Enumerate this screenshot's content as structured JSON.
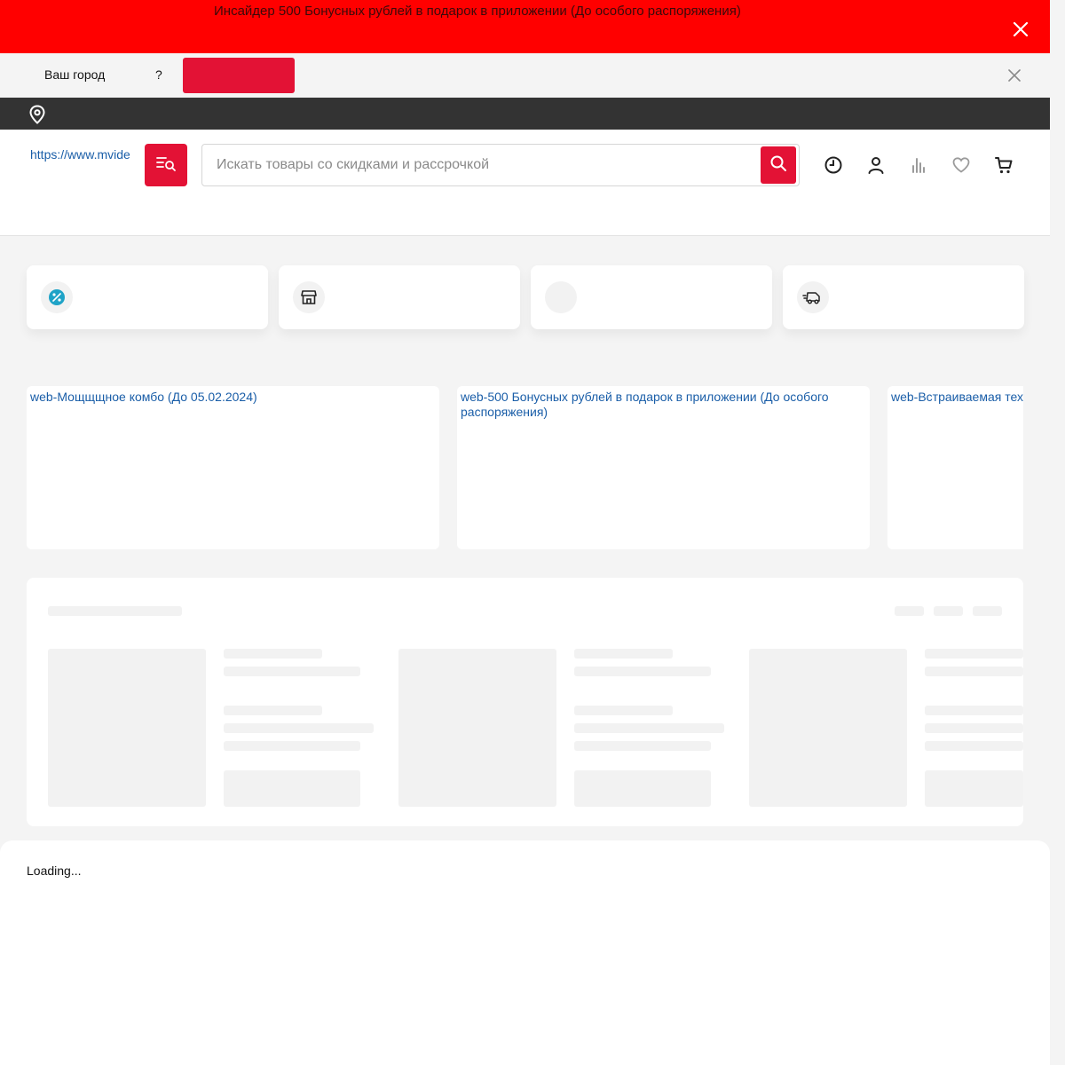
{
  "promo": {
    "text": "Инсайдер 500 Бонусных рублей в подарок в приложении (До особого распоряжения)",
    "close_icon": "close-icon"
  },
  "city": {
    "label": "Ваш город",
    "question": "?",
    "confirm_label": "",
    "close_icon": "close-icon"
  },
  "header": {
    "logo_link": "https://www.mvideo.ru",
    "search_placeholder": "Искать товары со скидками и рассрочкой",
    "icons": [
      "history-icon",
      "user-icon",
      "compare-icon",
      "heart-icon",
      "cart-icon"
    ]
  },
  "quick_links": [
    {
      "icon": "percent-icon"
    },
    {
      "icon": "store-icon"
    },
    {
      "icon": ""
    },
    {
      "icon": "delivery-truck-icon"
    }
  ],
  "banners": [
    {
      "label": "web-Мощщщное комбо (До 05.02.2024)"
    },
    {
      "label": "web-500 Бонусных рублей в подарок в приложении (До особого распоряжения)"
    },
    {
      "label": "web-Встраиваемая техника"
    }
  ],
  "loading": {
    "text": "Loading..."
  },
  "colors": {
    "accent": "#e31235",
    "promo": "#ff0000",
    "dark_bar": "#333333",
    "link": "#1a5ea8"
  }
}
